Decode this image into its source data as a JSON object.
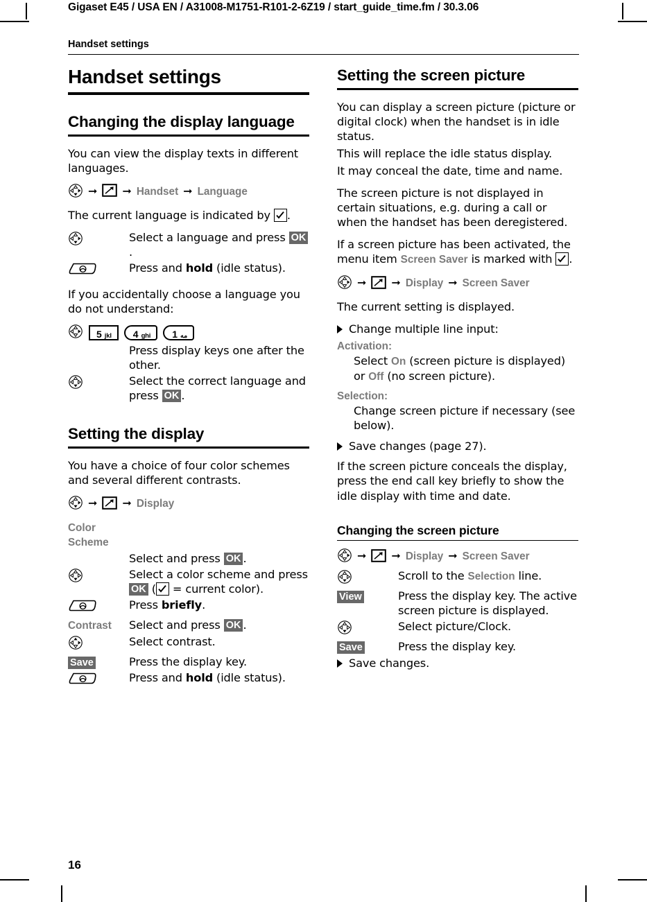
{
  "print_header": {
    "text": "Gigaset E45 / USA EN / A31008-M1751-R101-2-6Z19  / start_guide_time.fm / 30.3.06"
  },
  "running_header": {
    "text": "Handset settings"
  },
  "page_number": "16",
  "left_column": {
    "title": "Handset settings",
    "section_language": {
      "heading": "Changing the display language",
      "intro": "You can view the display texts in different languages.",
      "path": {
        "menu1": "Handset",
        "menu2": "Language"
      },
      "indicated_pre": "The current language is indicated by",
      "indicated_post": ".",
      "steps": [
        {
          "key_icon": "nav-key-icon",
          "desc_pre": "Select a language and press ",
          "dkey": "OK",
          "desc_post": "."
        },
        {
          "key_icon": "end-call-key-icon",
          "desc_pre": "Press and ",
          "bold": "hold",
          "desc_post": " (idle status)."
        }
      ],
      "accidental_note": "If you accidentally choose a language you do not understand:",
      "key_sequence": [
        {
          "digit": "5",
          "letters": "jkl",
          "shape": "square"
        },
        {
          "digit": "4",
          "letters": "ghi",
          "shape": "round"
        },
        {
          "digit": "1",
          "letters": "مه",
          "shape": "round"
        }
      ],
      "key_sequence_desc": "Press display keys one after the other.",
      "final_step": {
        "key_icon": "nav-key-icon",
        "desc_pre": "Select the correct language and press ",
        "dkey": "OK",
        "desc_post": "."
      }
    },
    "section_display": {
      "heading": "Setting the display",
      "intro": "You have a choice of four color schemes and several different contrasts.",
      "path": {
        "menu1": "Display"
      },
      "rows": [
        {
          "key_label": "Color Scheme",
          "key_icon": null,
          "desc": ""
        },
        {
          "key_label": null,
          "key_icon": null,
          "desc_pre": "Select and press ",
          "dkey": "OK",
          "desc_post": "."
        },
        {
          "key_label": null,
          "key_icon": "nav-key-icon",
          "desc_pre": "Select a color scheme and press ",
          "dkey": "OK",
          "desc_mid": " (",
          "checkbox": true,
          "desc_post": " = current color)."
        },
        {
          "key_label": null,
          "key_icon": "end-call-key-icon",
          "desc_pre": "Press ",
          "bold": "briefly",
          "desc_post": "."
        },
        {
          "key_label": "Contrast",
          "key_icon": null,
          "desc_pre": "Select and press ",
          "dkey": "OK",
          "desc_post": "."
        },
        {
          "key_label": null,
          "key_icon": "nav-key-icon",
          "desc_pre": "Select contrast.",
          "desc_post": ""
        },
        {
          "key_label": null,
          "key_icon": "display-key-save",
          "dkey": "Save",
          "desc_pre": "Press the display key.",
          "desc_post": ""
        },
        {
          "key_label": null,
          "key_icon": "end-call-key-icon",
          "desc_pre": "Press and ",
          "bold": "hold",
          "desc_post": " (idle status)."
        }
      ]
    }
  },
  "right_column": {
    "section_screen_picture": {
      "heading": "Setting the screen picture",
      "para1": "You can display a screen picture (picture or digital clock) when the handset is in idle status.",
      "para1b": "This will replace the idle status display.",
      "para1c": "It may conceal the date, time and name.",
      "para2": "The screen picture is not displayed in certain situations, e.g. during a call or when the handset has been deregistered.",
      "para3_pre": "If a screen picture has been activated, the menu item ",
      "para3_menu": "Screen Saver",
      "para3_mid": " is marked with ",
      "para3_post": ".",
      "path": {
        "menu1": "Display",
        "menu2": "Screen Saver"
      },
      "current_setting": "The current setting is displayed.",
      "bullet_change": "Change multiple line input:",
      "activation_label": "Activation:",
      "activation_pre": "Select ",
      "activation_on": "On",
      "activation_mid": " (screen picture is displayed) or ",
      "activation_off": "Off",
      "activation_post": " (no screen picture).",
      "selection_label": "Selection:",
      "selection_body": "Change screen picture if necessary (see below).",
      "bullet_save": "Save changes (page 27).",
      "para4": "If the screen picture conceals the display, press the end call key briefly to show the idle display with time and date."
    },
    "section_changing_picture": {
      "heading": "Changing the screen picture",
      "path": {
        "menu1": "Display",
        "menu2": "Screen Saver"
      },
      "rows": [
        {
          "key_icon": "nav-key-icon",
          "desc_pre": "Scroll to the ",
          "menu": "Selection",
          "desc_post": " line."
        },
        {
          "key_icon": "display-key-view",
          "dkey": "View",
          "desc_pre": "Press the display key. The active screen picture is displayed.",
          "desc_post": ""
        },
        {
          "key_icon": "nav-key-icon",
          "desc_pre": "Select picture/Clock.",
          "desc_post": ""
        },
        {
          "key_icon": "display-key-save",
          "dkey": "Save",
          "desc_pre": "Press the display key.",
          "desc_post": ""
        }
      ],
      "bullet_save": "Save changes."
    }
  },
  "colors": {
    "menu_gray": "#7b7b7b",
    "display_key_bg": "#686868",
    "text": "#000000"
  }
}
